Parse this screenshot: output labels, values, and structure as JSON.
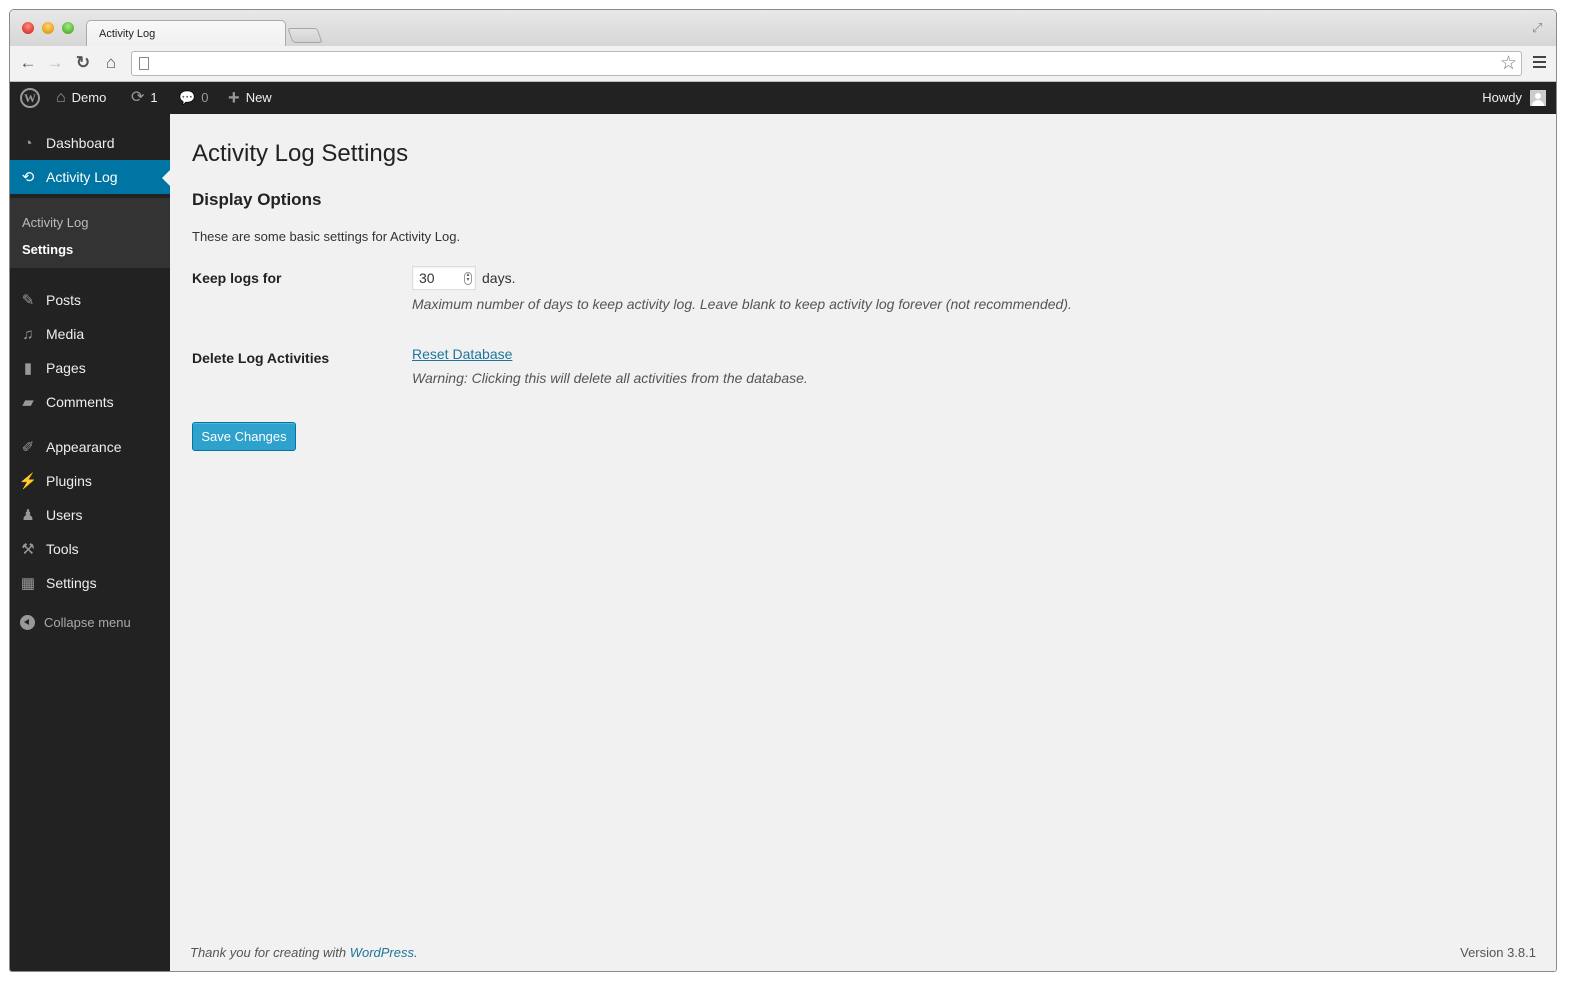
{
  "browser": {
    "tab_title": "Activity Log",
    "address": "",
    "icons": {
      "back": "←",
      "forward": "→",
      "reload": "↻",
      "home": "⌂",
      "star": "☆",
      "fullscreen": "⤢"
    }
  },
  "adminbar": {
    "site_name": "Demo",
    "updates_count": "1",
    "comments_count": "0",
    "new_label": "New",
    "howdy": "Howdy",
    "icons": {
      "wp_logo": "W",
      "home": "⌂",
      "updates": "⟳",
      "comment": "💬",
      "plus": "+"
    }
  },
  "sidebar": {
    "items": [
      {
        "label": "Dashboard",
        "icon": "◔"
      },
      {
        "label": "Activity Log",
        "icon": "⟲"
      },
      {
        "label": "Posts",
        "icon": "✎"
      },
      {
        "label": "Media",
        "icon": "♫"
      },
      {
        "label": "Pages",
        "icon": "▮"
      },
      {
        "label": "Comments",
        "icon": "▰"
      },
      {
        "label": "Appearance",
        "icon": "✐"
      },
      {
        "label": "Plugins",
        "icon": "⚡"
      },
      {
        "label": "Users",
        "icon": "♟"
      },
      {
        "label": "Tools",
        "icon": "⚒"
      },
      {
        "label": "Settings",
        "icon": "▦"
      }
    ],
    "submenu": [
      {
        "label": "Activity Log"
      },
      {
        "label": "Settings"
      }
    ],
    "collapse_label": "Collapse menu"
  },
  "main": {
    "page_title": "Activity Log Settings",
    "section_title": "Display Options",
    "intro": "These are some basic settings for Activity Log.",
    "keep_logs": {
      "label": "Keep logs for",
      "value": "30",
      "suffix": "days.",
      "description": "Maximum number of days to keep activity log. Leave blank to keep activity log forever (not recommended)."
    },
    "delete_logs": {
      "label": "Delete Log Activities",
      "link": "Reset Database",
      "warning": "Warning: Clicking this will delete all activities from the database."
    },
    "save_label": "Save Changes"
  },
  "footer": {
    "thanks_prefix": "Thank you for creating with ",
    "thanks_link": "WordPress",
    "thanks_suffix": ".",
    "version": "Version 3.8.1"
  },
  "colors": {
    "accent": "#0074a2",
    "button": "#2ea2cc",
    "link": "#21759b",
    "sidebar_bg": "#222222",
    "content_bg": "#f1f1f1"
  }
}
